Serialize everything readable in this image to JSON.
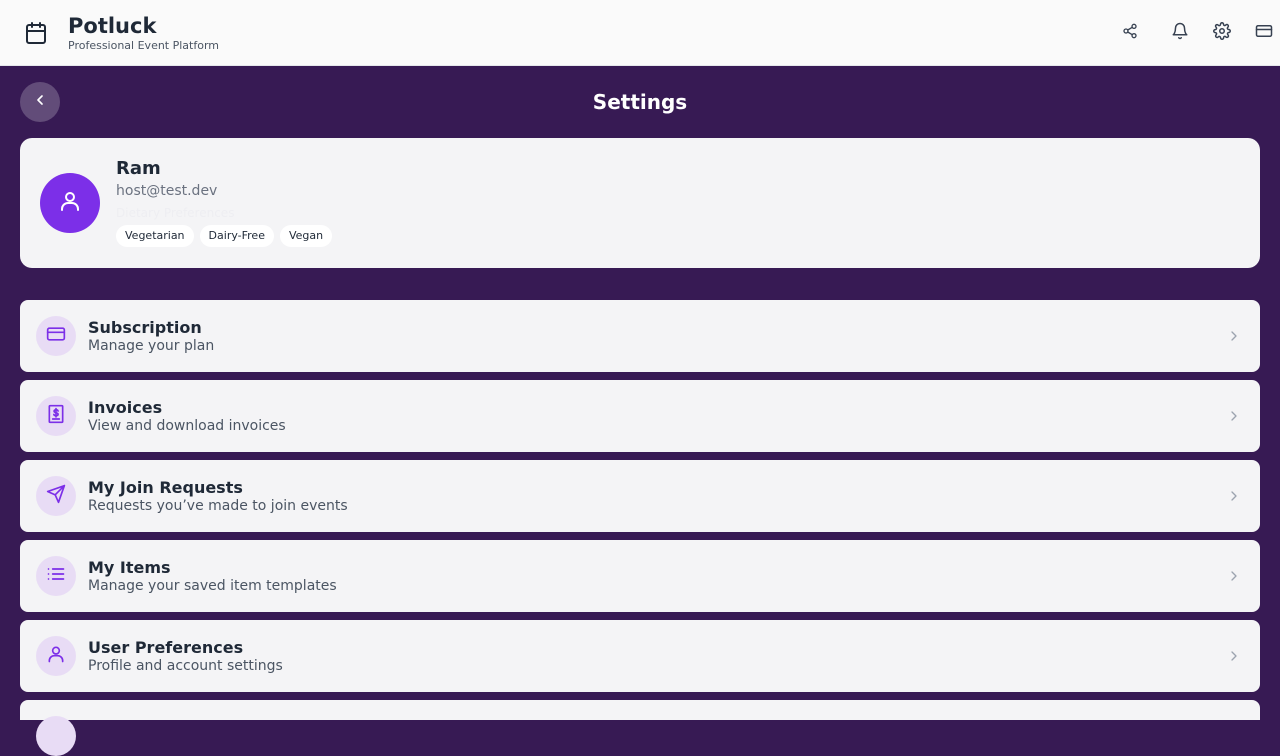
{
  "app": {
    "title": "Potluck",
    "subtitle": "Professional Event Platform"
  },
  "header": {
    "icons": [
      "share-icon",
      "bell-icon",
      "gear-icon",
      "credit-card-icon"
    ]
  },
  "page": {
    "title": "Settings"
  },
  "profile": {
    "name": "Ram",
    "email": "host@test.dev",
    "dietary_label": "Dietary Preferences",
    "tags": [
      "Vegetarian",
      "Dairy-Free",
      "Vegan"
    ]
  },
  "menu": [
    {
      "title": "Subscription",
      "subtitle": "Manage your plan",
      "icon": "credit-card-icon"
    },
    {
      "title": "Invoices",
      "subtitle": "View and download invoices",
      "icon": "invoice-icon"
    },
    {
      "title": "My Join Requests",
      "subtitle": "Requests you’ve made to join events",
      "icon": "send-icon"
    },
    {
      "title": "My Items",
      "subtitle": "Manage your saved item templates",
      "icon": "list-icon"
    },
    {
      "title": "User Preferences",
      "subtitle": "Profile and account settings",
      "icon": "user-icon"
    }
  ],
  "colors": {
    "page_bg": "#371a54",
    "accent": "#7c2fe8",
    "card_bg": "#f4f4f6",
    "icon_bubble": "#e8dcf5"
  }
}
